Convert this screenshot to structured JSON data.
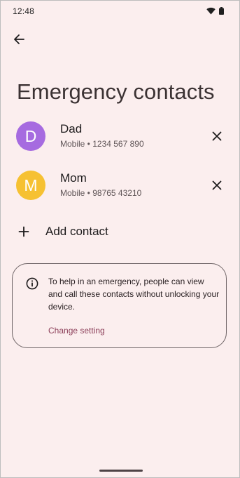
{
  "status_bar": {
    "time": "12:48",
    "icons": [
      "wifi-icon",
      "battery-icon"
    ]
  },
  "header": {
    "back_icon": "arrow-left-icon"
  },
  "page": {
    "title": "Emergency contacts"
  },
  "contacts": [
    {
      "initial": "D",
      "name": "Dad",
      "detail": "Mobile • 1234 567 890",
      "avatar_color": "#a66be0",
      "remove_icon": "close-icon"
    },
    {
      "initial": "M",
      "name": "Mom",
      "detail": "Mobile • 98765 43210",
      "avatar_color": "#f6c132",
      "remove_icon": "close-icon"
    }
  ],
  "add_contact": {
    "label": "Add contact",
    "icon": "plus-icon"
  },
  "info_card": {
    "icon": "info-icon",
    "text": "To help in an emergency, people can view and call these contacts without unlocking your device.",
    "link": "Change setting"
  },
  "colors": {
    "background": "#fbeeee",
    "accent_link": "#8c3f59",
    "avatar_dad": "#a66be0",
    "avatar_mom": "#f6c132"
  }
}
